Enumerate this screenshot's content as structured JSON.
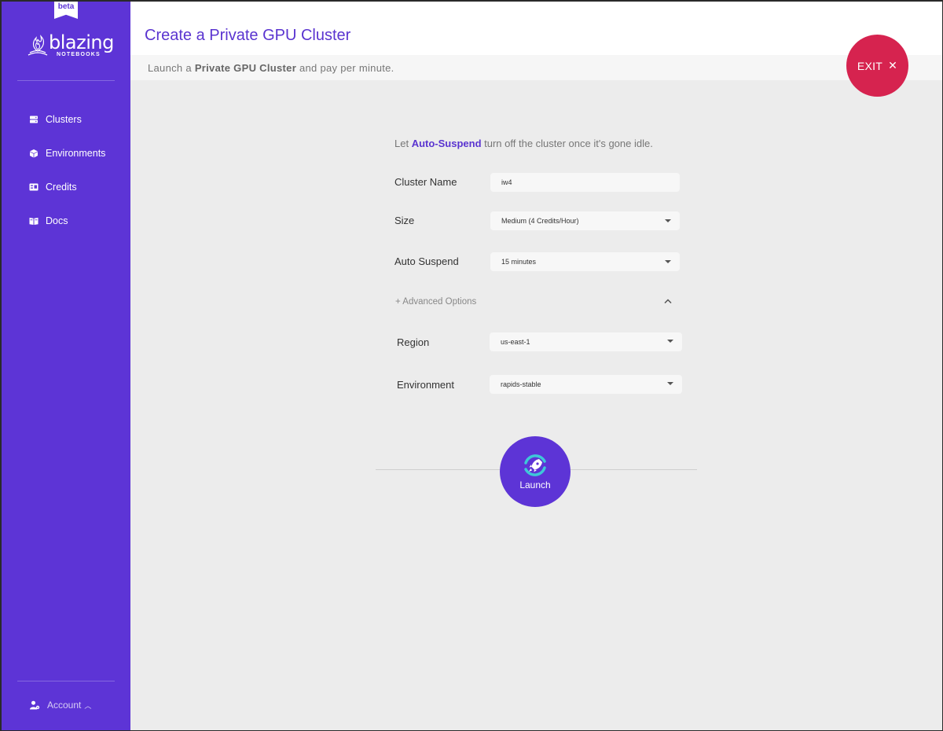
{
  "sidebar": {
    "beta": "beta",
    "logo_word": "blazing",
    "logo_sub": "NOTEBOOKS",
    "items": [
      {
        "label": "Clusters",
        "icon": "server-icon"
      },
      {
        "label": "Environments",
        "icon": "cube-icon"
      },
      {
        "label": "Credits",
        "icon": "credits-icon"
      },
      {
        "label": "Docs",
        "icon": "book-icon"
      }
    ],
    "account": "Account"
  },
  "header": {
    "title": "Create a Private GPU Cluster",
    "subtitle_prefix": "Launch a ",
    "subtitle_bold": "Private GPU Cluster",
    "subtitle_suffix": " and pay per minute."
  },
  "exit": {
    "label": "EXIT",
    "icon": "close-icon"
  },
  "form": {
    "intro_prefix": "Let ",
    "intro_bold": "Auto-Suspend",
    "intro_suffix": " turn off the cluster once it's gone idle.",
    "cluster_name": {
      "label": "Cluster Name",
      "value": "iw4"
    },
    "size": {
      "label": "Size",
      "value": "Medium (4 Credits/Hour)"
    },
    "auto_suspend": {
      "label": "Auto Suspend",
      "value": "15 minutes"
    },
    "advanced": "+ Advanced Options",
    "region": {
      "label": "Region",
      "value": "us-east-1"
    },
    "environment": {
      "label": "Environment",
      "value": "rapids-stable"
    }
  },
  "launch": {
    "label": "Launch",
    "icon": "rocket-icon"
  },
  "colors": {
    "primary": "#5d34d6",
    "exit": "#d6234f",
    "background": "#ececec"
  }
}
